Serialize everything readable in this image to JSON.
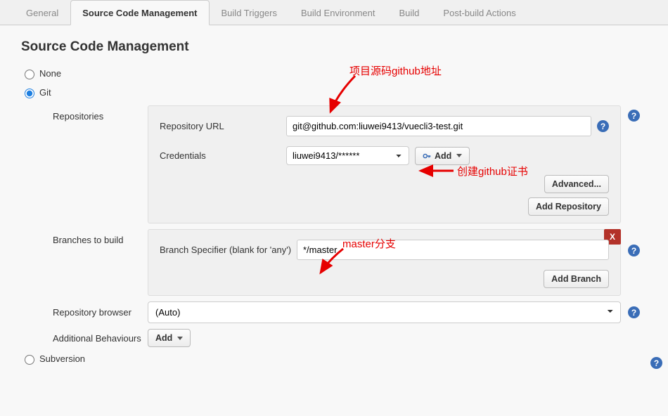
{
  "tabs": {
    "general": "General",
    "scm": "Source Code Management",
    "triggers": "Build Triggers",
    "env": "Build Environment",
    "build": "Build",
    "post": "Post-build Actions"
  },
  "sectionTitle": "Source Code Management",
  "options": {
    "none": "None",
    "git": "Git",
    "svn": "Subversion"
  },
  "git": {
    "repositoriesLabel": "Repositories",
    "repoUrlLabel": "Repository URL",
    "repoUrlValue": "git@github.com:liuwei9413/vuecli3-test.git",
    "credentialsLabel": "Credentials",
    "credentialsValue": "liuwei9413/******",
    "addBtn": "Add",
    "advancedBtn": "Advanced...",
    "addRepoBtn": "Add Repository",
    "branchesLabel": "Branches to build",
    "branchSpecLabel": "Branch Specifier (blank for 'any')",
    "branchSpecValue": "*/master",
    "addBranchBtn": "Add Branch",
    "deleteX": "X",
    "repoBrowserLabel": "Repository browser",
    "repoBrowserValue": "(Auto)",
    "addlBehavLabel": "Additional Behaviours",
    "addlBehavBtn": "Add"
  },
  "annotations": {
    "repoUrl": "项目源码github地址",
    "credentials": "创建github证书",
    "branch": "master分支"
  },
  "helpGlyph": "?"
}
